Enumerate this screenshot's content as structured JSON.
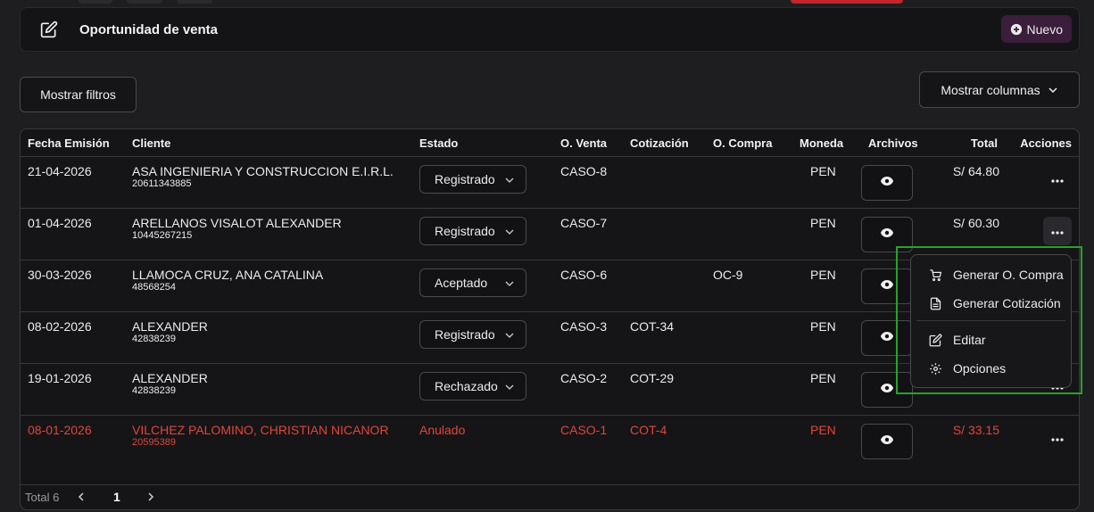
{
  "header": {
    "title": "Oportunidad de venta",
    "new_button": "Nuevo"
  },
  "toolbar": {
    "filters_button": "Mostrar filtros",
    "columns_button": "Mostrar columnas"
  },
  "columns": [
    "Fecha Emisión",
    "Cliente",
    "Estado",
    "O. Venta",
    "Cotización",
    "O. Compra",
    "Moneda",
    "Archivos",
    "Total",
    "Acciones"
  ],
  "rows": [
    {
      "fecha": "21-04-2026",
      "cliente": "ASA INGENIERIA Y CONSTRUCCION E.I.R.L.",
      "doc": "20611343885",
      "estado": "Registrado",
      "venta": "CASO-8",
      "cotizacion": "",
      "compra": "",
      "moneda": "PEN",
      "total": "S/ 64.80"
    },
    {
      "fecha": "01-04-2026",
      "cliente": "ARELLANOS VISALOT ALEXANDER",
      "doc": "10445267215",
      "estado": "Registrado",
      "venta": "CASO-7",
      "cotizacion": "",
      "compra": "",
      "moneda": "PEN",
      "total": "S/ 60.30"
    },
    {
      "fecha": "30-03-2026",
      "cliente": "LLAMOCA CRUZ, ANA CATALINA",
      "doc": "48568254",
      "estado": "Aceptado",
      "venta": "CASO-6",
      "cotizacion": "",
      "compra": "OC-9",
      "moneda": "PEN",
      "total": ""
    },
    {
      "fecha": "08-02-2026",
      "cliente": "ALEXANDER",
      "doc": "42838239",
      "estado": "Registrado",
      "venta": "CASO-3",
      "cotizacion": "COT-34",
      "compra": "",
      "moneda": "PEN",
      "total": ""
    },
    {
      "fecha": "19-01-2026",
      "cliente": "ALEXANDER",
      "doc": "42838239",
      "estado": "Rechazado",
      "venta": "CASO-2",
      "cotizacion": "COT-29",
      "compra": "",
      "moneda": "PEN",
      "total": ""
    },
    {
      "fecha": "08-01-2026",
      "cliente": "VILCHEZ PALOMINO, CHRISTIAN NICANOR",
      "doc": "20595389",
      "estado": "Anulado",
      "venta": "CASO-1",
      "cotizacion": "COT-4",
      "compra": "",
      "moneda": "PEN",
      "total": "S/ 33.15"
    }
  ],
  "pagination": {
    "total": "Total 6",
    "page": "1"
  },
  "menu": {
    "items": [
      "Generar O. Compra",
      "Generar Cotización",
      "Editar",
      "Opciones"
    ]
  },
  "colors": {
    "accent": "#3a1e3c",
    "anulado": "#e2453c",
    "highlight": "#27a327"
  }
}
